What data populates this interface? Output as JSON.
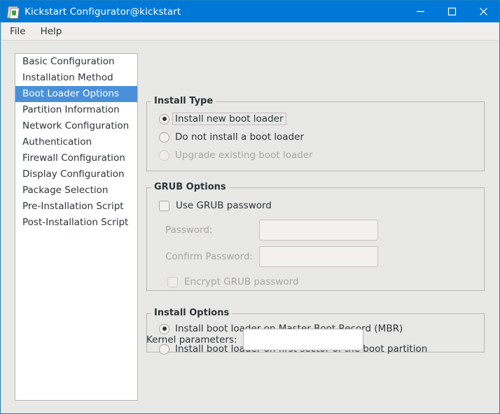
{
  "window": {
    "title": "Kickstart Configurator@kickstart",
    "icon": "app-icon",
    "accent_color": "#0078d7",
    "controls": {
      "minimize": "minimize-icon",
      "maximize": "maximize-icon",
      "close": "close-icon"
    }
  },
  "menubar": {
    "items": [
      {
        "label": "File"
      },
      {
        "label": "Help"
      }
    ]
  },
  "sidebar": {
    "selected_index": 2,
    "selection_color": "#4a90d9",
    "items": [
      {
        "label": "Basic Configuration"
      },
      {
        "label": "Installation Method"
      },
      {
        "label": "Boot Loader Options"
      },
      {
        "label": "Partition Information"
      },
      {
        "label": "Network Configuration"
      },
      {
        "label": "Authentication"
      },
      {
        "label": "Firewall Configuration"
      },
      {
        "label": "Display Configuration"
      },
      {
        "label": "Package Selection"
      },
      {
        "label": "Pre-Installation Script"
      },
      {
        "label": "Post-Installation Script"
      }
    ]
  },
  "install_type": {
    "title": "Install Type",
    "options": [
      {
        "label": "Install new boot loader",
        "checked": true,
        "disabled": false,
        "focused": true
      },
      {
        "label": "Do not install a boot loader",
        "checked": false,
        "disabled": false,
        "focused": false
      },
      {
        "label": "Upgrade existing boot loader",
        "checked": false,
        "disabled": true,
        "focused": false
      }
    ]
  },
  "grub_options": {
    "title": "GRUB Options",
    "use_password": {
      "label": "Use GRUB password",
      "checked": false,
      "disabled": false
    },
    "password": {
      "label": "Password:",
      "value": "",
      "placeholder": "",
      "disabled": true
    },
    "confirm_password": {
      "label": "Confirm Password:",
      "value": "",
      "placeholder": "",
      "disabled": true
    },
    "encrypt": {
      "label": "Encrypt GRUB password",
      "checked": false,
      "disabled": true
    }
  },
  "install_options": {
    "title": "Install Options",
    "options": [
      {
        "label": "Install boot loader on Master Boot Record (MBR)",
        "checked": true
      },
      {
        "label": "Install boot loader on first sector of the boot partition",
        "checked": false
      }
    ]
  },
  "kernel_parameters": {
    "label": "Kernel parameters:",
    "value": "",
    "placeholder": ""
  }
}
